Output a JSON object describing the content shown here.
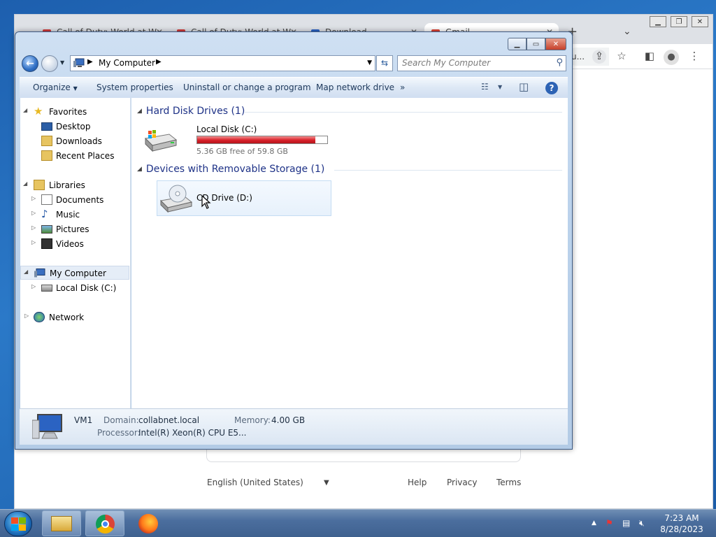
{
  "chrome": {
    "tabs": [
      {
        "label": "Call of Duty: World at W"
      },
      {
        "label": "Call of Duty: World at W"
      },
      {
        "label": "Download"
      },
      {
        "label": "Gmail"
      }
    ],
    "omni_fragment": "u...",
    "footer": {
      "language": "English (United States)",
      "help": "Help",
      "privacy": "Privacy",
      "terms": "Terms"
    }
  },
  "explorer": {
    "address": "My Computer",
    "search_placeholder": "Search My Computer",
    "commands": [
      "Organize",
      "System properties",
      "Uninstall or change a program",
      "Map network drive"
    ],
    "more": "»",
    "nav": {
      "favorites": {
        "label": "Favorites",
        "items": [
          "Desktop",
          "Downloads",
          "Recent Places"
        ]
      },
      "libraries": {
        "label": "Libraries",
        "items": [
          "Documents",
          "Music",
          "Pictures",
          "Videos"
        ]
      },
      "computer": {
        "label": "My Computer",
        "items": [
          "Local Disk (C:)"
        ]
      },
      "network": {
        "label": "Network"
      }
    },
    "groups": {
      "hdd": {
        "title": "Hard Disk Drives (1)"
      },
      "removable": {
        "title": "Devices with Removable Storage (1)"
      }
    },
    "drives": {
      "c": {
        "name": "Local Disk (C:)",
        "free": "5.36 GB free of 59.8 GB",
        "used_fraction": 0.91
      },
      "d": {
        "name": "CD Drive (D:)"
      }
    },
    "details": {
      "name": "VM1",
      "domain_label": "Domain:",
      "domain": "collabnet.local",
      "memory_label": "Memory:",
      "memory": "4.00 GB",
      "processor_label": "Processor:",
      "processor": "Intel(R) Xeon(R) CPU E5..."
    }
  },
  "taskbar": {
    "time": "7:23 AM",
    "date": "8/28/2023"
  },
  "colors": {
    "accent": "#1e3287",
    "disk_bar": "#d8212a"
  }
}
